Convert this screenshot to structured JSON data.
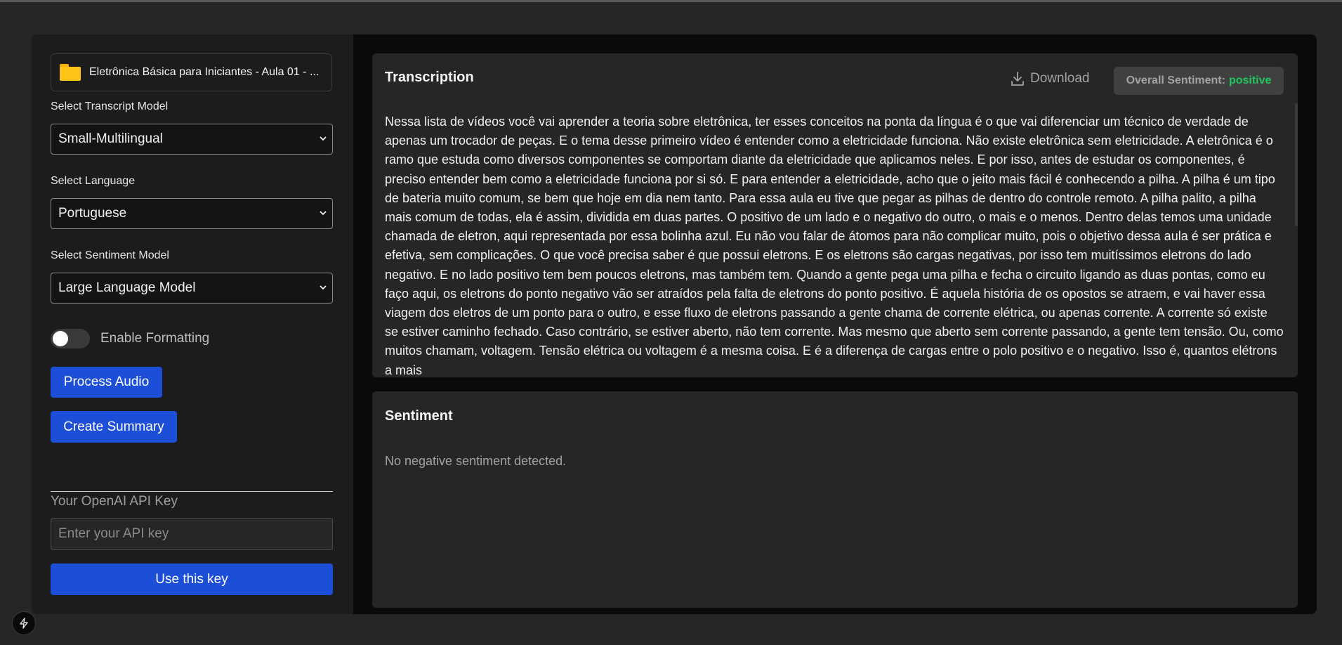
{
  "sidebar": {
    "file_name": "Eletrônica Básica para Iniciantes - Aula 01 - ...",
    "transcript_model_label": "Select Transcript Model",
    "transcript_model_value": "Small-Multilingual",
    "language_label": "Select Language",
    "language_value": "Portuguese",
    "sentiment_model_label": "Select Sentiment Model",
    "sentiment_model_value": "Large Language Model",
    "formatting_toggle_label": "Enable Formatting",
    "formatting_enabled": false,
    "process_audio_label": "Process Audio",
    "create_summary_label": "Create Summary",
    "api_key_label": "Your OpenAI API Key",
    "api_key_placeholder": "Enter your API key",
    "use_key_label": "Use this key"
  },
  "transcription": {
    "title": "Transcription",
    "download_label": "Download",
    "overall_sentiment_label": "Overall Sentiment:",
    "overall_sentiment_value": "positive",
    "text": "Nessa lista de vídeos você vai aprender a teoria sobre eletrônica, ter esses conceitos na ponta da língua é o que vai diferenciar um técnico de verdade de apenas um trocador de peças. E o tema desse primeiro vídeo é entender como a eletricidade funciona. Não existe eletrônica sem eletricidade. A eletrônica é o ramo que estuda como diversos componentes se comportam diante da eletricidade que aplicamos neles. E por isso, antes de estudar os componentes, é preciso entender bem como a eletricidade funciona por si só. E para entender a eletricidade, acho que o jeito mais fácil é conhecendo a pilha. A pilha é um tipo de bateria muito comum, se bem que hoje em dia nem tanto. Para essa aula eu tive que pegar as pilhas de dentro do controle remoto. A pilha palito, a pilha mais comum de todas, ela é assim, dividida em duas partes. O positivo de um lado e o negativo do outro, o mais e o menos. Dentro delas temos uma unidade chamada de eletron, aqui representada por essa bolinha azul. Eu não vou falar de átomos para não complicar muito, pois o objetivo dessa aula é ser prática e efetiva, sem complicações. O que você precisa saber é que possui eletrons. E os eletrons são cargas negativas, por isso tem muitíssimos eletrons do lado negativo. E no lado positivo tem bem poucos eletrons, mas também tem. Quando a gente pega uma pilha e fecha o circuito ligando as duas pontas, como eu faço aqui, os eletrons do ponto negativo vão ser atraídos pela falta de eletrons do ponto positivo. É aquela história de os opostos se atraem, e vai haver essa viagem dos eletros de um ponto para o outro, e esse fluxo de eletrons passando a gente chama de corrente elétrica, ou apenas corrente. A corrente só existe se estiver caminho fechado. Caso contrário, se estiver aberto, não tem corrente. Mas mesmo que aberto sem corrente passando, a gente tem tensão. Ou, como muitos chamam, voltagem. Tensão elétrica ou voltagem é a mesma coisa. E é a diferença de cargas entre o polo positivo e o negativo. Isso é, quantos elétrons a mais"
  },
  "sentiment": {
    "title": "Sentiment",
    "message": "No negative sentiment detected."
  },
  "colors": {
    "accent_blue": "#1d4ed8",
    "positive_green": "#22c55e",
    "folder_yellow": "#fcc419"
  },
  "icons": {
    "file": "folder-icon",
    "select": "chevron-down-icon",
    "download": "download-icon",
    "corner": "bolt-icon"
  }
}
